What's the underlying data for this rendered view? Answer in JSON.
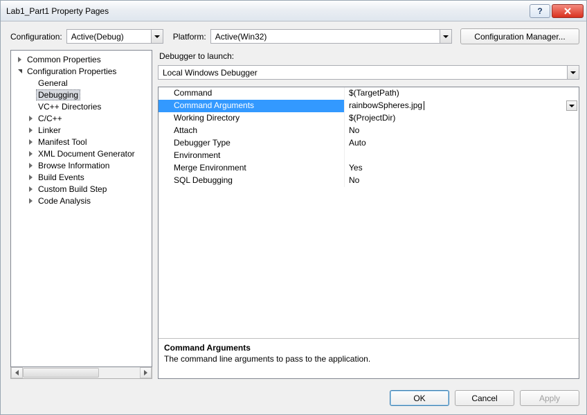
{
  "window": {
    "title": "Lab1_Part1 Property Pages"
  },
  "toolbar": {
    "config_label": "Configuration:",
    "config_value": "Active(Debug)",
    "platform_label": "Platform:",
    "platform_value": "Active(Win32)",
    "config_manager": "Configuration Manager..."
  },
  "tree": {
    "items": [
      {
        "label": "Common Properties",
        "depth": 0,
        "glyph": "closed"
      },
      {
        "label": "Configuration Properties",
        "depth": 0,
        "glyph": "open"
      },
      {
        "label": "General",
        "depth": 1,
        "glyph": "none"
      },
      {
        "label": "Debugging",
        "depth": 1,
        "glyph": "none",
        "selected": true
      },
      {
        "label": "VC++ Directories",
        "depth": 1,
        "glyph": "none"
      },
      {
        "label": "C/C++",
        "depth": 1,
        "glyph": "closed"
      },
      {
        "label": "Linker",
        "depth": 1,
        "glyph": "closed"
      },
      {
        "label": "Manifest Tool",
        "depth": 1,
        "glyph": "closed"
      },
      {
        "label": "XML Document Generator",
        "depth": 1,
        "glyph": "closed"
      },
      {
        "label": "Browse Information",
        "depth": 1,
        "glyph": "closed"
      },
      {
        "label": "Build Events",
        "depth": 1,
        "glyph": "closed"
      },
      {
        "label": "Custom Build Step",
        "depth": 1,
        "glyph": "closed"
      },
      {
        "label": "Code Analysis",
        "depth": 1,
        "glyph": "closed"
      }
    ]
  },
  "launch": {
    "label": "Debugger to launch:",
    "value": "Local Windows Debugger"
  },
  "grid": {
    "rows": [
      {
        "label": "Command",
        "value": "$(TargetPath)"
      },
      {
        "label": "Command Arguments",
        "value": "rainbowSpheres.jpg",
        "selected": true,
        "editing": true,
        "dropdown": true
      },
      {
        "label": "Working Directory",
        "value": "$(ProjectDir)"
      },
      {
        "label": "Attach",
        "value": "No"
      },
      {
        "label": "Debugger Type",
        "value": "Auto"
      },
      {
        "label": "Environment",
        "value": ""
      },
      {
        "label": "Merge Environment",
        "value": "Yes"
      },
      {
        "label": "SQL Debugging",
        "value": "No"
      }
    ]
  },
  "desc": {
    "title": "Command Arguments",
    "text": "The command line arguments to pass to the application."
  },
  "footer": {
    "ok": "OK",
    "cancel": "Cancel",
    "apply": "Apply"
  }
}
